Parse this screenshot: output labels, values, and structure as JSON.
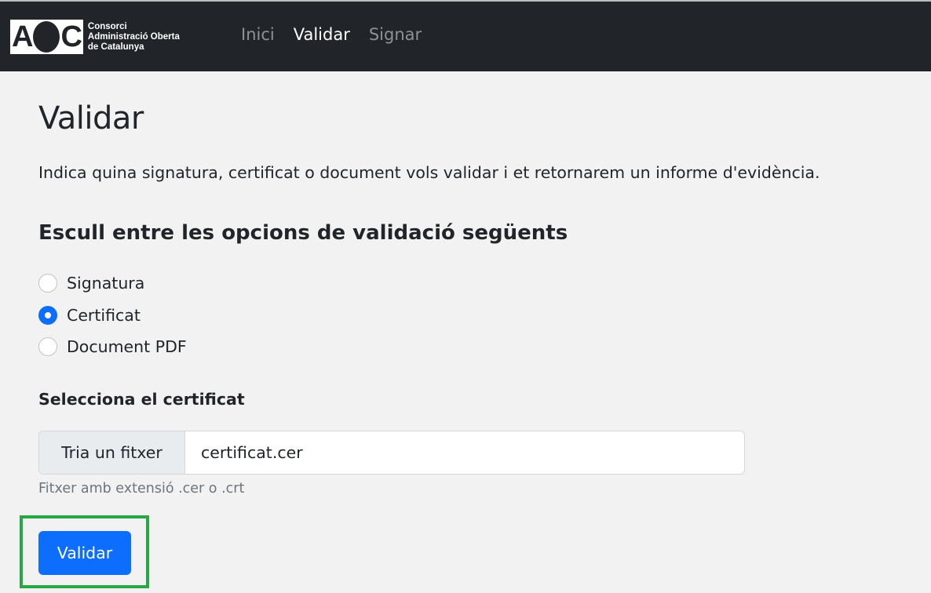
{
  "header": {
    "logo": {
      "letters": [
        "A",
        "C"
      ],
      "text_lines": [
        "Consorci",
        "Administració Oberta",
        "de Catalunya"
      ]
    },
    "nav": [
      {
        "label": "Inici",
        "active": false
      },
      {
        "label": "Validar",
        "active": true
      },
      {
        "label": "Signar",
        "active": false
      }
    ]
  },
  "main": {
    "title": "Validar",
    "intro": "Indica quina signatura, certificat o document vols validar i et retornarem un informe d'evidència.",
    "options_title": "Escull entre les opcions de validació següents",
    "options": [
      {
        "label": "Signatura",
        "checked": false
      },
      {
        "label": "Certificat",
        "checked": true
      },
      {
        "label": "Document PDF",
        "checked": false
      }
    ],
    "file_field": {
      "label": "Selecciona el certificat",
      "button_label": "Tria un fitxer",
      "value": "certificat.cer",
      "help": "Fitxer amb extensió .cer o .crt"
    },
    "submit_label": "Validar"
  },
  "colors": {
    "navbar": "#212529",
    "primary": "#0d6efd",
    "highlight": "#28a745"
  }
}
